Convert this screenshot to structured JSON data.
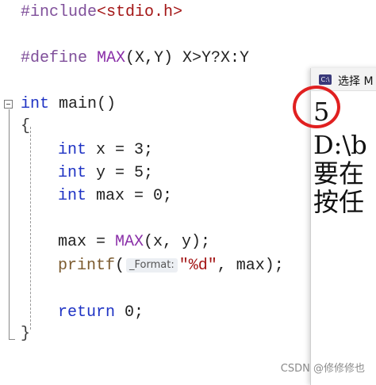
{
  "editor": {
    "lines": {
      "l1_directive": "#include",
      "l1_header": "<stdio.h>",
      "l3_directive": "#define ",
      "l3_macro": "MAX",
      "l3_params": "(X,Y) X>Y?X:Y",
      "l5_kw": "int",
      "l5_rest": " main()",
      "l6": "{",
      "l7_kw": "int",
      "l7_rest": " x = 3;",
      "l8_kw": "int",
      "l8_rest": " y = 5;",
      "l9_kw": "int",
      "l9_rest": " max = 0;",
      "l11_pre": "max = ",
      "l11_macro": "MAX",
      "l11_post": "(x, y);",
      "l12_fn": "printf",
      "l12_open": "(",
      "l12_hint": "_Format:",
      "l12_str": "\"%d\"",
      "l12_post": ", max);",
      "l14_kw": "return",
      "l14_rest": " 0;",
      "l15": "}"
    }
  },
  "console": {
    "title": "选择 M",
    "app_icon": "C:\\",
    "lines": [
      "5",
      "D:\\b",
      "要在",
      "按任"
    ]
  },
  "annotation": {
    "color": "#e02020"
  },
  "watermark": "CSDN @修修修也"
}
